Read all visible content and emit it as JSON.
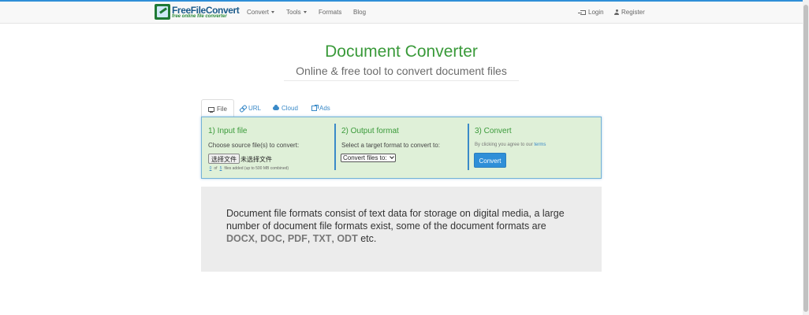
{
  "nav": {
    "logo_title": "FreeFileConvert",
    "logo_subtitle": "free online file converter",
    "convert": "Convert",
    "tools": "Tools",
    "formats": "Formats",
    "blog": "Blog",
    "login": "Login",
    "register": "Register"
  },
  "header": {
    "title": "Document Converter",
    "subtitle": "Online & free tool to convert document files"
  },
  "tabs": [
    {
      "label": "File",
      "icon": "monitor-icon",
      "active": true
    },
    {
      "label": "URL",
      "icon": "link-icon",
      "active": false
    },
    {
      "label": "Cloud",
      "icon": "cloud-icon",
      "active": false
    },
    {
      "label": "Ads",
      "icon": "external-link-icon",
      "active": false
    }
  ],
  "steps": {
    "input": {
      "title": "1) Input file",
      "text": "Choose source file(s) to convert:",
      "file_button": "选择文件",
      "no_file": "未选择文件",
      "count_current": "0",
      "count_of": "of",
      "count_max": "5",
      "count_suffix": "files added (up to 500 MB combined)"
    },
    "output": {
      "title": "2) Output format",
      "text": "Select a target format to convert to:",
      "select_value": "Convert files to:"
    },
    "convert": {
      "title": "3) Convert",
      "terms_prefix": "By clicking you agree to our",
      "terms_link": "terms",
      "button": "Convert"
    }
  },
  "info": {
    "text_before": "Document file formats consist of text data for storage on digital media, a large number of document file formats exist, some of the document formats are",
    "formats": [
      "DOCX",
      "DOC",
      "PDF",
      "TXT",
      "ODT"
    ],
    "separator": ", ",
    "text_after": "etc."
  },
  "colors": {
    "accent": "#2f8fd8",
    "title_green": "#3a9a3a",
    "panel_bg": "#dff0d8",
    "info_bg": "#ececec"
  }
}
